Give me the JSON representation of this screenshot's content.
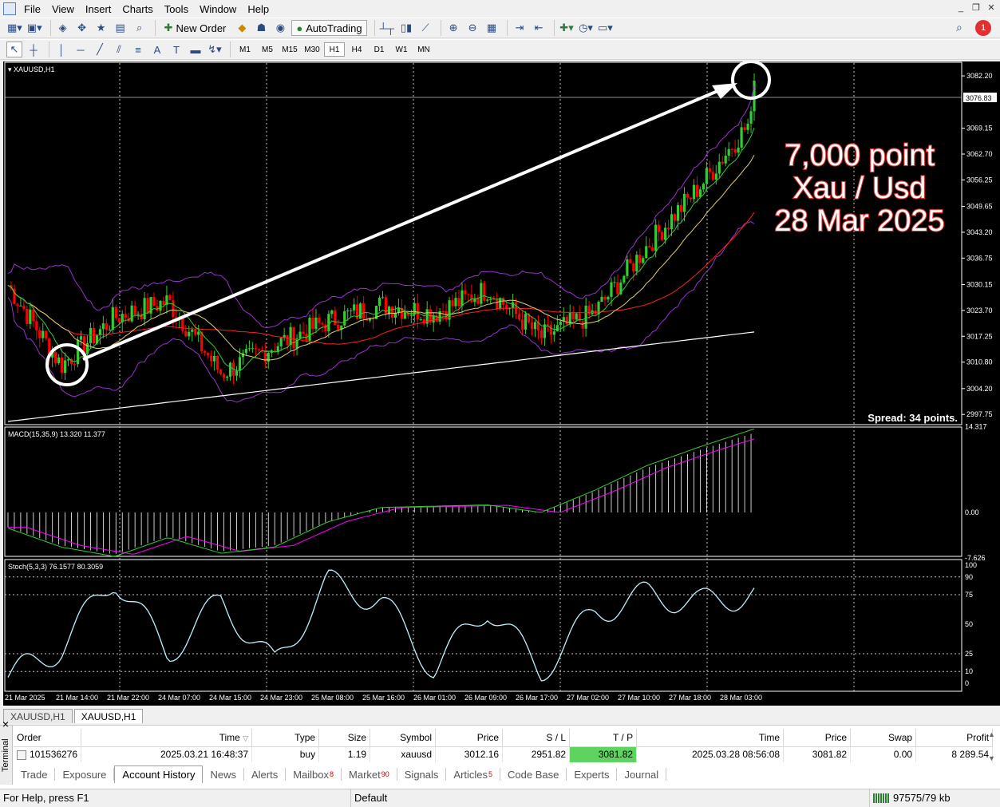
{
  "menu": [
    "File",
    "View",
    "Insert",
    "Charts",
    "Tools",
    "Window",
    "Help"
  ],
  "toolbar": {
    "new_order": "New Order",
    "autotrading": "AutoTrading",
    "notification_count": "1"
  },
  "timeframes": [
    "M1",
    "M5",
    "M15",
    "M30",
    "H1",
    "H4",
    "D1",
    "W1",
    "MN"
  ],
  "active_timeframe": "H1",
  "chart": {
    "symbol_label": "XAUUSD,H1",
    "current_price": "3076.83",
    "price_ticks": [
      "3082.20",
      "3069.15",
      "3062.70",
      "3056.25",
      "3049.65",
      "3043.20",
      "3036.75",
      "3030.15",
      "3023.70",
      "3017.25",
      "3010.80",
      "3004.20",
      "2997.75"
    ],
    "time_ticks": [
      "21 Mar 2025",
      "21 Mar 14:00",
      "21 Mar 22:00",
      "24 Mar 07:00",
      "24 Mar 15:00",
      "24 Mar 23:00",
      "25 Mar 08:00",
      "25 Mar 16:00",
      "26 Mar 01:00",
      "26 Mar 09:00",
      "26 Mar 17:00",
      "27 Mar 02:00",
      "27 Mar 10:00",
      "27 Mar 18:00",
      "28 Mar 03:00"
    ],
    "spread_text": "Spread: 34 points.",
    "annotation": [
      "7,000 point",
      "Xau / Usd",
      "28 Mar 2025"
    ],
    "macd_label": "MACD(15,35,9) 13.320 11.377",
    "macd_ticks": [
      "14.317",
      "0.00",
      "-7.626"
    ],
    "stoch_label": "Stoch(5,3,3) 76.1577 80.3059",
    "stoch_ticks": [
      "100",
      "90",
      "75",
      "50",
      "25",
      "10",
      "0"
    ]
  },
  "chart_tabs": [
    "XAUUSD,H1",
    "XAUUSD,H1"
  ],
  "history": {
    "columns": [
      "Order",
      "Time",
      "Type",
      "Size",
      "Symbol",
      "Price",
      "S / L",
      "T / P",
      "Time",
      "Price",
      "Swap",
      "Profit"
    ],
    "row": [
      "101536276",
      "2025.03.21 16:48:37",
      "buy",
      "1.19",
      "xauusd",
      "3012.16",
      "2951.82",
      "3081.82",
      "2025.03.28 08:56:08",
      "3081.82",
      "0.00",
      "8 289.54"
    ]
  },
  "terminal_label": "Terminal",
  "terminal_tabs": [
    {
      "label": "Trade",
      "badge": ""
    },
    {
      "label": "Exposure",
      "badge": ""
    },
    {
      "label": "Account History",
      "badge": ""
    },
    {
      "label": "News",
      "badge": ""
    },
    {
      "label": "Alerts",
      "badge": ""
    },
    {
      "label": "Mailbox",
      "badge": "8"
    },
    {
      "label": "Market",
      "badge": "90"
    },
    {
      "label": "Signals",
      "badge": ""
    },
    {
      "label": "Articles",
      "badge": "5"
    },
    {
      "label": "Code Base",
      "badge": ""
    },
    {
      "label": "Experts",
      "badge": ""
    },
    {
      "label": "Journal",
      "badge": ""
    }
  ],
  "active_terminal_tab": "Account History",
  "status": {
    "help": "For Help, press F1",
    "profile": "Default",
    "traffic": "97575/79 kb"
  },
  "colors": {
    "bull": "#32cd32",
    "bear": "#ff0000",
    "tp_highlight": "#5fd35f",
    "background": "#000000"
  },
  "chart_data": {
    "type": "line",
    "symbol": "XAUUSD",
    "timeframe": "H1",
    "x": [
      "21 Mar 2025",
      "21 Mar 14:00",
      "21 Mar 22:00",
      "24 Mar 07:00",
      "24 Mar 15:00",
      "24 Mar 23:00",
      "25 Mar 08:00",
      "25 Mar 16:00",
      "26 Mar 01:00",
      "26 Mar 09:00",
      "26 Mar 17:00",
      "27 Mar 02:00",
      "27 Mar 10:00",
      "27 Mar 18:00",
      "28 Mar 03:00"
    ],
    "series": [
      {
        "name": "",
        "values": [
          3030,
          3010,
          3022,
          3026,
          3008,
          3015,
          3021,
          3025,
          3023,
          3029,
          3017,
          3023,
          3040,
          3055,
          3072
        ]
      }
    ],
    "ylim": [
      2996,
      3085
    ],
    "macd": [
      -2.5,
      -5.5,
      -7.0,
      -4.0,
      -6.5,
      -5.5,
      -1.5,
      0.8,
      1.0,
      1.2,
      0.0,
      3.5,
      7.5,
      10.5,
      13.3
    ],
    "stochastic": [
      5,
      30,
      90,
      25,
      70,
      15,
      85,
      70,
      12,
      65,
      10,
      60,
      75,
      68,
      76
    ]
  }
}
